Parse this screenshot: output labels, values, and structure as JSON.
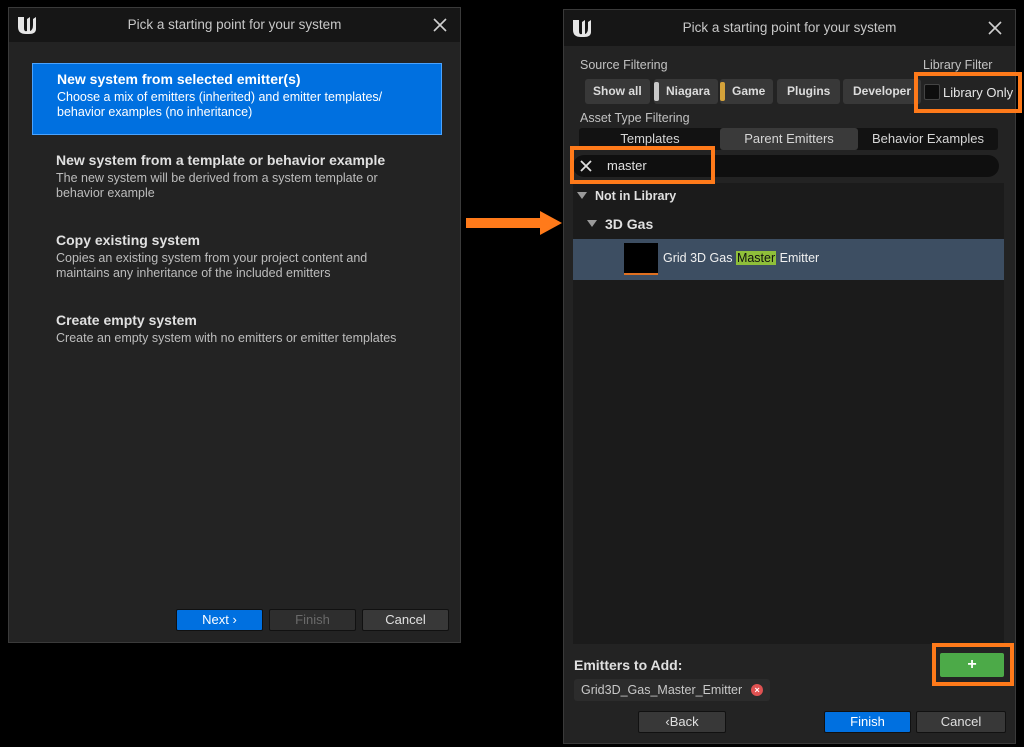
{
  "left_dialog": {
    "title": "Pick a starting point for your system",
    "options": [
      {
        "title": "New system from selected emitter(s)",
        "desc": "Choose a mix of emitters (inherited) and emitter templates/ behavior examples (no inheritance)"
      },
      {
        "title": "New system from a template or behavior example",
        "desc": "The new system will be derived from a system template or behavior example"
      },
      {
        "title": "Copy existing system",
        "desc": "Copies an existing system from your project content and maintains any inheritance of the included emitters"
      },
      {
        "title": "Create empty system",
        "desc": "Create an empty system with no emitters or emitter templates"
      }
    ],
    "buttons": {
      "next": "Next",
      "finish": "Finish",
      "cancel": "Cancel"
    }
  },
  "right_dialog": {
    "title": "Pick a starting point for your system",
    "source_filtering_label": "Source Filtering",
    "library_filter_label": "Library Filter",
    "source_chips": [
      {
        "label": "Show all",
        "tag_color": ""
      },
      {
        "label": "Niagara",
        "tag_color": "#c8c8c8"
      },
      {
        "label": "Game",
        "tag_color": "#d4a23a"
      },
      {
        "label": "Plugins",
        "tag_color": ""
      },
      {
        "label": "Developer",
        "tag_color": ""
      }
    ],
    "library_only_label": "Library Only",
    "asset_type_label": "Asset Type Filtering",
    "asset_tabs": [
      "Templates",
      "Parent Emitters",
      "Behavior Examples"
    ],
    "active_tab": "Parent Emitters",
    "search_value": "master",
    "tree": {
      "group": "Not in Library",
      "category": "3D Gas",
      "item_prefix": "Grid 3D Gas ",
      "item_highlight": "Master",
      "item_suffix": " Emitter"
    },
    "emitters_to_add_label": "Emitters to Add:",
    "emitters_to_add": [
      "Grid3D_Gas_Master_Emitter"
    ],
    "add_button_label": "+",
    "buttons": {
      "back": "Back",
      "finish": "Finish",
      "cancel": "Cancel"
    }
  },
  "colors": {
    "accent_blue": "#0070e0",
    "callout_orange": "#ff7a1a",
    "add_green": "#4caa48",
    "search_highlight": "#8fbf3a"
  }
}
